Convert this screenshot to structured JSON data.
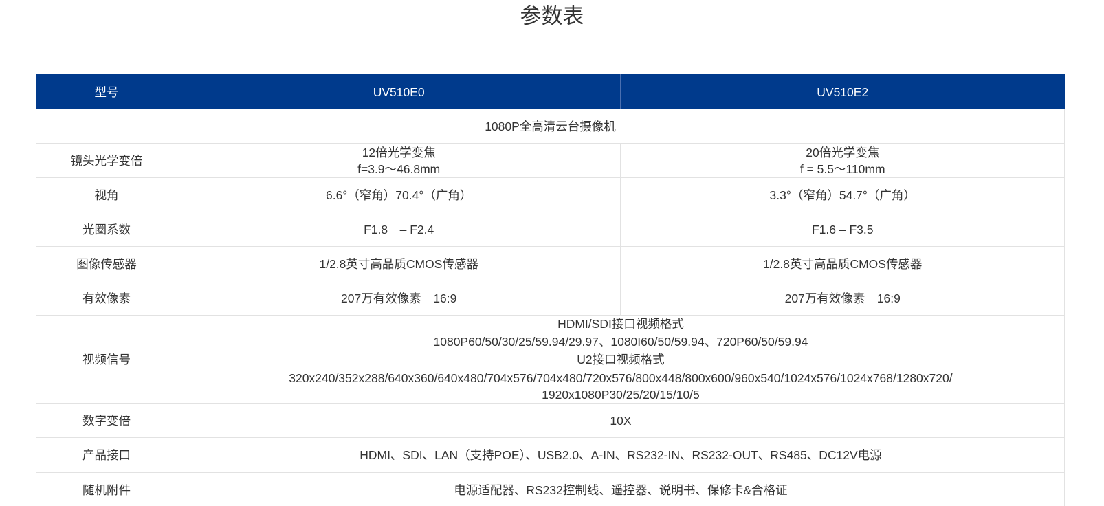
{
  "title": "参数表",
  "table": {
    "header": {
      "label": "型号",
      "model_a": "UV510E0",
      "model_b": "UV510E2"
    },
    "product_name": "1080P全高清云台摄像机",
    "rows": {
      "lens": {
        "label": "镜头光学变倍",
        "a_line1": "12倍光学变焦",
        "a_line2": "f=3.9～46.8mm",
        "b_line1": "20倍光学变焦",
        "b_line2": "f = 5.5～110mm"
      },
      "fov": {
        "label": "视角",
        "a": "6.6°（窄角）70.4°（广角）",
        "b": "3.3°（窄角）54.7°（广角）"
      },
      "aperture": {
        "label": "光圈系数",
        "a": "F1.8　– F2.4",
        "b": "F1.6 – F3.5"
      },
      "sensor": {
        "label": "图像传感器",
        "a": "1/2.8英寸高品质CMOS传感器",
        "b": "1/2.8英寸高品质CMOS传感器"
      },
      "pixels": {
        "label": "有效像素",
        "a": "207万有效像素　16:9",
        "b": "207万有效像素　16:9"
      },
      "video": {
        "label": "视频信号",
        "line1": "HDMI/SDI接口视频格式",
        "line2": "1080P60/50/30/25/59.94/29.97、1080I60/50/59.94、720P60/50/59.94",
        "line3": "U2接口视频格式",
        "line4a": "320x240/352x288/640x360/640x480/704x576/704x480/720x576/800x448/800x600/960x540/1024x576/1024x768/1280x720/",
        "line4b": "1920x1080P30/25/20/15/10/5"
      },
      "digital_zoom": {
        "label": "数字变倍",
        "value": "10X"
      },
      "interfaces": {
        "label": "产品接口",
        "value": "HDMI、SDI、LAN（支持POE）、USB2.0、A-IN、RS232-IN、RS232-OUT、RS485、DC12V电源"
      },
      "accessories": {
        "label": "随机附件",
        "value": "电源适配器、RS232控制线、遥控器、说明书、保修卡&合格证"
      }
    }
  }
}
